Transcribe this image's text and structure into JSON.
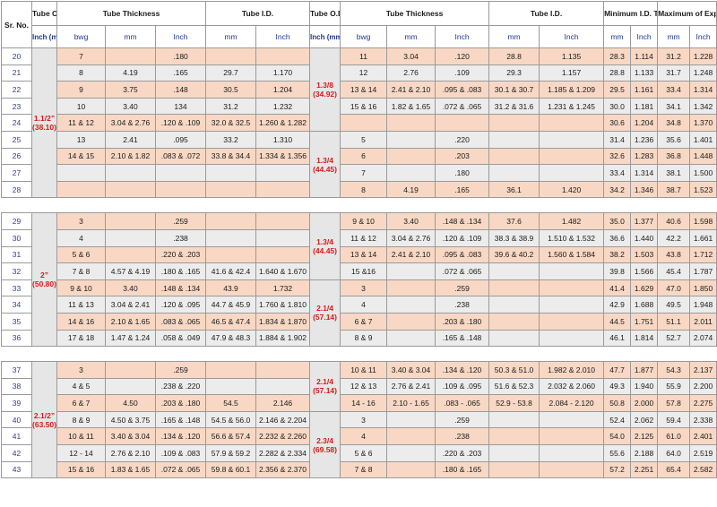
{
  "headers": {
    "sr_no": "Sr. No.",
    "tube_od": "Tube O.D.",
    "tube_thickness": "Tube Thickness",
    "tube_id": "Tube I.D.",
    "min_id": "Minimum I.D. Tool Enters",
    "max_exp": "Maximum of Expansion Tool",
    "inch_mm": "Inch (mm)",
    "bwg": "bwg",
    "mm": "mm",
    "inch": "Inch"
  },
  "groups": [
    {
      "rows": [
        {
          "sr": "20",
          "a": [
            "7",
            "",
            "",
            "",
            ".180",
            "",
            "",
            "11",
            "3.04",
            ".120",
            "28.8",
            "1.135",
            "28.3",
            "1.114",
            "31.2",
            "1.228"
          ]
        },
        {
          "sr": "21",
          "a": [
            "",
            "8",
            "4.19",
            ".165",
            "29.7",
            "1.170",
            "12",
            "2.76",
            ".109",
            "29.3",
            "1.157",
            "28.8",
            "1.133",
            "31.7",
            "1.248"
          ]
        },
        {
          "sr": "22",
          "a": [
            "",
            "9",
            "3.75",
            ".148",
            "30.5",
            "1.204",
            "13 & 14",
            "2.41 & 2.10",
            ".095 & .083",
            "30.1 & 30.7",
            "1.185 & 1.209",
            "29.5",
            "1.161",
            "33.4",
            "1.314"
          ]
        },
        {
          "sr": "23",
          "a": [
            "",
            "10",
            "3.40",
            "134",
            "31.2",
            "1.232",
            "15 & 16",
            "1.82 & 1.65",
            ".072 & .065",
            "31.2 & 31.6",
            "1.231 & 1.245",
            "30.0",
            "1.181",
            "34.1",
            "1.342"
          ]
        },
        {
          "sr": "24",
          "a": [
            "",
            "11 & 12",
            "3.04 & 2.76",
            ".120 & .109",
            "32.0 & 32.5",
            "1.260 & 1.282",
            "",
            "",
            "",
            "",
            "",
            "30.6",
            "1.204",
            "34.8",
            "1.370"
          ]
        },
        {
          "sr": "25",
          "a": [
            "",
            "13",
            "2.41",
            ".095",
            "33.2",
            "1.310",
            "5",
            "",
            ".220",
            "",
            "",
            "31.4",
            "1.236",
            "35.6",
            "1.401"
          ]
        },
        {
          "sr": "26",
          "a": [
            "",
            "14 & 15",
            "2.10 & 1.82",
            ".083 & .072",
            "33.8 & 34.4",
            "1.334 & 1.356",
            "6",
            "",
            ".203",
            "",
            "",
            "32.6",
            "1.283",
            "36.8",
            "1.448"
          ]
        },
        {
          "sr": "27",
          "a": [
            "",
            "",
            "",
            "",
            "",
            "",
            "7",
            "",
            ".180",
            "",
            "",
            "33.4",
            "1.314",
            "38.1",
            "1.500"
          ]
        },
        {
          "sr": "28",
          "a": [
            "",
            "",
            "",
            "",
            "",
            "",
            "8",
            "4.19",
            ".165",
            "36.1",
            "1.420",
            "34.2",
            "1.346",
            "38.7",
            "1.523"
          ]
        }
      ]
    },
    {
      "rows": [
        {
          "sr": "29",
          "a": [
            "",
            "3",
            "",
            ".259",
            "",
            "",
            "9 & 10",
            "3.40",
            ".148 & .134",
            "37.6",
            "1.482",
            "35.0",
            "1.377",
            "40.6",
            "1.598"
          ]
        },
        {
          "sr": "30",
          "a": [
            "",
            "4",
            "",
            ".238",
            "",
            "",
            "11 & 12",
            "3.04 & 2.76",
            ".120 & .109",
            "38.3 & 38.9",
            "1.510 & 1.532",
            "36.6",
            "1.440",
            "42.2",
            "1.661"
          ]
        },
        {
          "sr": "31",
          "a": [
            "",
            "5 & 6",
            "",
            ".220 & .203",
            "",
            "",
            "13 & 14",
            "2.41 & 2.10",
            ".095 & .083",
            "39.6 & 40.2",
            "1.560 & 1.584",
            "38.2",
            "1.503",
            "43.8",
            "1.712"
          ]
        },
        {
          "sr": "32",
          "a": [
            "",
            "7 & 8",
            "4.57 & 4.19",
            ".180 & .165",
            "41.6 & 42.4",
            "1.640 & 1.670",
            "15 &16",
            "",
            ".072 & .065",
            "",
            "",
            "39.8",
            "1.566",
            "45.4",
            "1.787"
          ]
        },
        {
          "sr": "33",
          "a": [
            "",
            "9 & 10",
            "3.40",
            ".148 & .134",
            "43.9",
            "1.732",
            "3",
            "",
            ".259",
            "",
            "",
            "41.4",
            "1.629",
            "47.0",
            "1.850"
          ]
        },
        {
          "sr": "34",
          "a": [
            "",
            "11 & 13",
            "3.04 & 2.41",
            ".120 & .095",
            "44.7 & 45.9",
            "1.760 & 1.810",
            "4",
            "",
            ".238",
            "",
            "",
            "42.9",
            "1.688",
            "49.5",
            "1.948"
          ]
        },
        {
          "sr": "35",
          "a": [
            "",
            "14 & 16",
            "2.10 & 1.65",
            ".083 & .065",
            "46.5 & 47.4",
            "1.834 & 1.870",
            "6 & 7",
            "",
            ".203 & .180",
            "",
            "",
            "44.5",
            "1.751",
            "51.1",
            "2.011"
          ]
        },
        {
          "sr": "36",
          "a": [
            "",
            "17 & 18",
            "1.47 & 1.24",
            ".058 & .049",
            "47.9 & 48.3",
            "1.884 & 1.902",
            "8 & 9",
            "",
            ".165 & .148",
            "",
            "",
            "46.1",
            "1.814",
            "52.7",
            "2.074"
          ]
        }
      ]
    },
    {
      "rows": [
        {
          "sr": "37",
          "a": [
            "",
            "3",
            "",
            ".259",
            "",
            "",
            "10 & 11",
            "3.40 & 3.04",
            ".134 & .120",
            "50.3 & 51.0",
            "1.982 & 2.010",
            "47.7",
            "1.877",
            "54.3",
            "2.137"
          ]
        },
        {
          "sr": "38",
          "a": [
            "",
            "4 & 5",
            "",
            ".238 & .220",
            "",
            "",
            "12 & 13",
            "2.76 & 2.41",
            ".109 & .095",
            "51.6 & 52.3",
            "2.032 & 2.060",
            "49.3",
            "1.940",
            "55.9",
            "2.200"
          ]
        },
        {
          "sr": "39",
          "a": [
            "",
            "6 & 7",
            "4.50",
            ".203 & .180",
            "54.5",
            "2.146",
            "14 - 16",
            "2.10 - 1.65",
            ".083 - .065",
            "52.9 - 53.8",
            "2.084 - 2.120",
            "50.8",
            "2.000",
            "57.8",
            "2.275"
          ]
        },
        {
          "sr": "40",
          "a": [
            "",
            "8 & 9",
            "4.50 & 3.75",
            ".165 & .148",
            "54.5 & 56.0",
            "2.146 & 2.204",
            "3",
            "",
            ".259",
            "",
            "",
            "52.4",
            "2.062",
            "59.4",
            "2.338"
          ]
        },
        {
          "sr": "41",
          "a": [
            "",
            "10 & 11",
            "3.40 & 3.04",
            ".134 & .120",
            "56.6 & 57.4",
            "2.232 & 2.260",
            "4",
            "",
            ".238",
            "",
            "",
            "54.0",
            "2.125",
            "61.0",
            "2.401"
          ]
        },
        {
          "sr": "42",
          "a": [
            "",
            "12 - 14",
            "2.76 & 2.10",
            ".109 & .083",
            "57.9 & 59.2",
            "2.282 & 2.334",
            "5 & 6",
            "",
            ".220 & .203",
            "",
            "",
            "55.6",
            "2.188",
            "64.0",
            "2.519"
          ]
        },
        {
          "sr": "43",
          "a": [
            "",
            "15 & 16",
            "1.83 & 1.65",
            ".072 & .065",
            "59.8 & 60.1",
            "2.356 & 2.370",
            "7 & 8",
            "",
            ".180 & .165",
            "",
            "",
            "57.2",
            "2.251",
            "65.4",
            "2.582"
          ]
        }
      ]
    }
  ],
  "od_labels": {
    "g1_left": "1.1/2”\n(38.10)",
    "g1_right_a": "1.3/8\n(34.92)",
    "g1_right_b": "1.3/4\n(44.45)",
    "g2_left": "2”\n(50.80)",
    "g2_right_a": "1.3/4\n(44.45)",
    "g2_right_b": "2.1/4\n(57.14)",
    "g3_left": "2.1/2”\n(63.50)",
    "g3_right_a": "2.1/4\n(57.14)",
    "g3_right_b": "2.3/4\n(69.58)"
  }
}
